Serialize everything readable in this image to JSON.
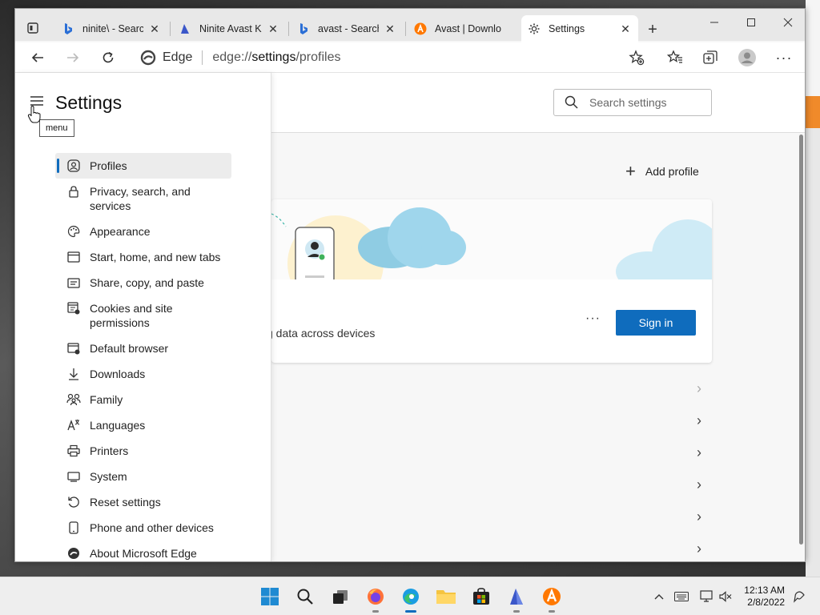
{
  "browser": {
    "tabs": [
      {
        "title": "ninite\\ - Search",
        "icon": "bing-icon"
      },
      {
        "title": "Ninite Avast Kr",
        "icon": "ninite-icon"
      },
      {
        "title": "avast - Search",
        "icon": "bing-icon"
      },
      {
        "title": "Avast | Downlo",
        "icon": "avast-icon"
      },
      {
        "title": "Settings",
        "icon": "gear-icon",
        "active": true
      }
    ],
    "address": {
      "site_label": "Edge",
      "url_prefix": "edge://",
      "url_host": "settings",
      "url_path": "/profiles"
    }
  },
  "settings": {
    "title": "Settings",
    "menu_tooltip": "menu",
    "search_placeholder": "Search settings",
    "nav_items": [
      {
        "label": "Profiles",
        "icon": "profile-icon",
        "active": true
      },
      {
        "label": "Privacy, search, and services",
        "icon": "lock-icon"
      },
      {
        "label": "Appearance",
        "icon": "appearance-icon"
      },
      {
        "label": "Start, home, and new tabs",
        "icon": "home-tabs-icon"
      },
      {
        "label": "Share, copy, and paste",
        "icon": "share-icon"
      },
      {
        "label": "Cookies and site permissions",
        "icon": "cookies-icon"
      },
      {
        "label": "Default browser",
        "icon": "default-browser-icon"
      },
      {
        "label": "Downloads",
        "icon": "download-icon"
      },
      {
        "label": "Family",
        "icon": "family-icon"
      },
      {
        "label": "Languages",
        "icon": "languages-icon"
      },
      {
        "label": "Printers",
        "icon": "printer-icon"
      },
      {
        "label": "System",
        "icon": "system-icon"
      },
      {
        "label": "Reset settings",
        "icon": "reset-icon"
      },
      {
        "label": "Phone and other devices",
        "icon": "phone-icon"
      },
      {
        "label": "About Microsoft Edge",
        "icon": "edge-icon"
      }
    ],
    "profile": {
      "add_profile": "Add profile",
      "sync_text": "g data across devices",
      "more": "···",
      "sign_in": "Sign in"
    }
  },
  "taskbar": {
    "time": "12:13 AM",
    "date": "2/8/2022"
  },
  "colors": {
    "accent": "#0f6cbd",
    "cloud": "#9fd6ec"
  }
}
